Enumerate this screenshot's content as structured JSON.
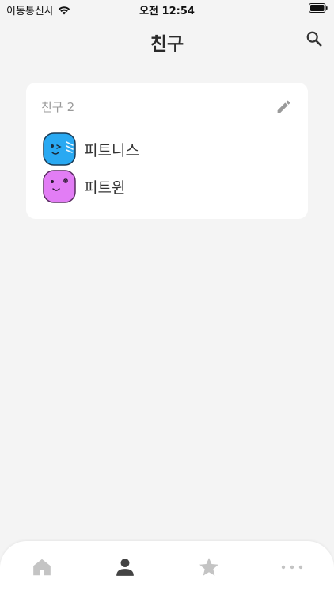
{
  "status_bar": {
    "carrier": "이동통신사",
    "time": "오전 12:54"
  },
  "header": {
    "title": "친구"
  },
  "friends_card": {
    "section_label": "친구",
    "count": "2",
    "friends": [
      {
        "name": "피트니스",
        "avatar_icon": "blue-winking-face-avatar",
        "avatar_color": "#29a9f2"
      },
      {
        "name": "피트윈",
        "avatar_icon": "pink-winking-face-avatar",
        "avatar_color": "#e27df5"
      }
    ]
  },
  "tab_bar": {
    "tabs": [
      {
        "icon": "home-icon",
        "active": false
      },
      {
        "icon": "person-icon",
        "active": true
      },
      {
        "icon": "star-icon",
        "active": false
      },
      {
        "icon": "more-icon",
        "active": false
      }
    ]
  },
  "colors": {
    "background": "#f4f4f4",
    "card": "#ffffff",
    "active_tab": "#444444",
    "inactive_tab": "#c4c4c4"
  }
}
